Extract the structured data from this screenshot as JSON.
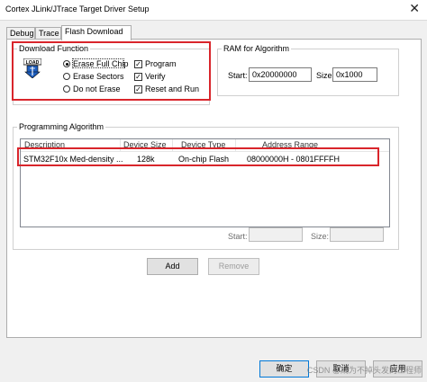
{
  "window": {
    "title": "Cortex JLink/JTrace Target Driver Setup",
    "close_glyph": "✕"
  },
  "tabs": [
    {
      "label": "Debug",
      "active": false
    },
    {
      "label": "Trace",
      "active": false
    },
    {
      "label": "Flash Download",
      "active": true
    }
  ],
  "download_function": {
    "legend": "Download Function",
    "icon_label": "LOAD",
    "erase_options": [
      {
        "label": "Erase Full Chip",
        "selected": true
      },
      {
        "label": "Erase Sectors",
        "selected": false
      },
      {
        "label": "Do not Erase",
        "selected": false
      }
    ],
    "checks": [
      {
        "label": "Program",
        "checked": true
      },
      {
        "label": "Verify",
        "checked": true
      },
      {
        "label": "Reset and Run",
        "checked": true
      }
    ]
  },
  "ram": {
    "legend": "RAM for Algorithm",
    "start_label": "Start:",
    "start_value": "0x20000000",
    "size_label": "Size:",
    "size_value": "0x1000"
  },
  "algorithm": {
    "legend": "Programming Algorithm",
    "columns": [
      "Description",
      "Device Size",
      "Device Type",
      "Address Range"
    ],
    "rows": [
      {
        "description": "STM32F10x Med-density ...",
        "size": "128k",
        "type": "On-chip Flash",
        "range": "08000000H - 0801FFFFH"
      }
    ],
    "start_label": "Start:",
    "start_value": "",
    "size_label": "Size:",
    "size_value": ""
  },
  "buttons": {
    "add": "Add",
    "remove": "Remove",
    "ok": "确定",
    "cancel": "取消",
    "apply": "应用"
  },
  "watermark": "CSDN @成为不掉头发的工程师",
  "colors": {
    "highlight": "#d9252b",
    "tab_border": "#adadad",
    "dialog_bg": "#f0f0f0"
  }
}
